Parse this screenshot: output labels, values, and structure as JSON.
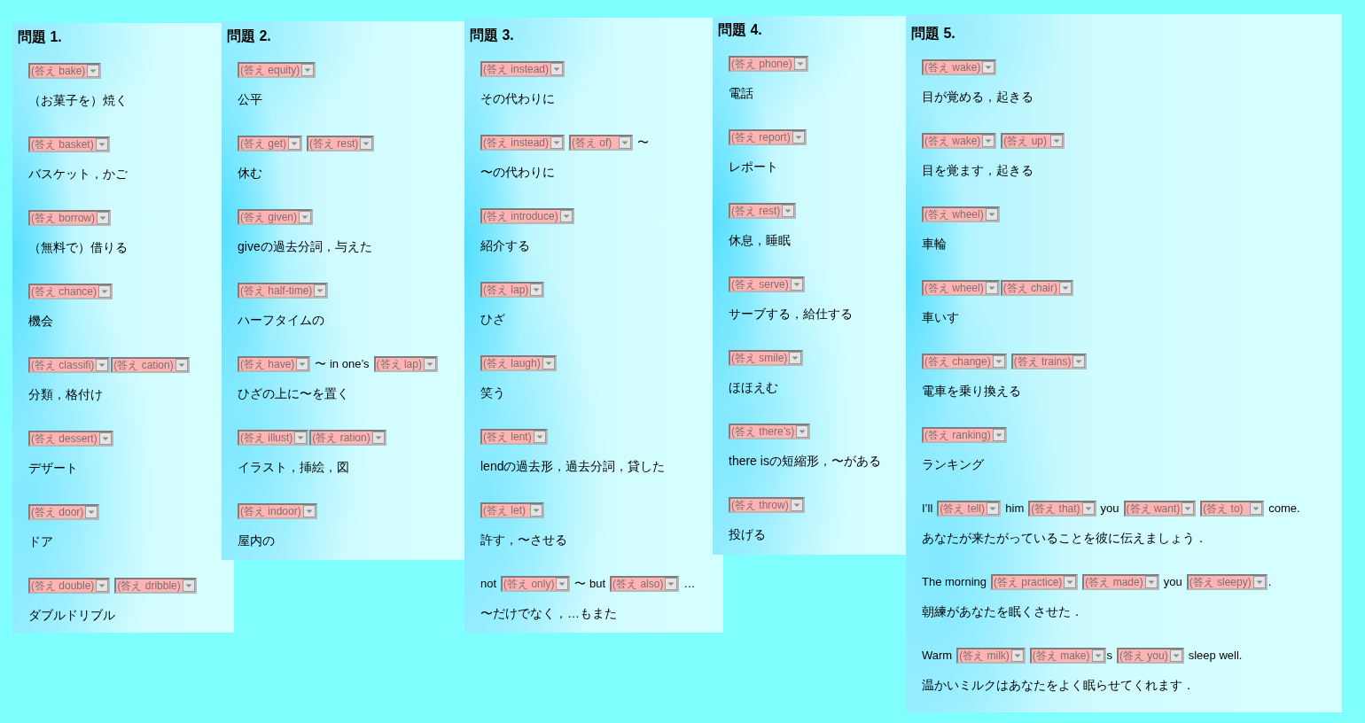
{
  "panels": [
    {
      "title": "問題 1.",
      "items": [
        {
          "prompt": [
            [
              {
                "kind": "select",
                "value": "(答え bake)",
                "disabled": true
              }
            ]
          ],
          "meaning": "（お菓子を）焼く"
        },
        {
          "prompt": [
            [
              {
                "kind": "select",
                "value": "(答え basket)",
                "disabled": true
              }
            ]
          ],
          "meaning": "バスケット，かご"
        },
        {
          "prompt": [
            [
              {
                "kind": "select",
                "value": "(答え borrow)",
                "disabled": true
              }
            ]
          ],
          "meaning": "（無料で）借りる"
        },
        {
          "prompt": [
            [
              {
                "kind": "select",
                "value": "(答え chance)",
                "disabled": true
              }
            ]
          ],
          "meaning": "機会"
        },
        {
          "prompt": [
            [
              {
                "kind": "select",
                "value": "(答え classifi)",
                "disabled": true
              },
              {
                "kind": "select",
                "value": "(答え cation)",
                "disabled": true
              }
            ]
          ],
          "meaning": "分類，格付け"
        },
        {
          "prompt": [
            [
              {
                "kind": "select",
                "value": "(答え dessert)",
                "disabled": true
              }
            ]
          ],
          "meaning": "デザート"
        },
        {
          "prompt": [
            [
              {
                "kind": "select",
                "value": "(答え door)",
                "disabled": true
              }
            ]
          ],
          "meaning": "ドア"
        },
        {
          "prompt": [
            [
              {
                "kind": "select",
                "value": "(答え double)",
                "disabled": true
              }
            ],
            [
              {
                "kind": "select",
                "value": "(答え dribble)",
                "disabled": true
              }
            ]
          ],
          "meaning": "ダブルドリブル"
        }
      ]
    },
    {
      "title": "問題 2.",
      "items": [
        {
          "prompt": [
            [
              {
                "kind": "select",
                "value": "(答え equity)",
                "disabled": true
              }
            ]
          ],
          "meaning": "公平"
        },
        {
          "prompt": [
            [
              {
                "kind": "select",
                "value": "(答え get)",
                "disabled": true
              }
            ],
            [
              {
                "kind": "select",
                "value": "(答え rest)",
                "disabled": true
              }
            ]
          ],
          "meaning": "休む"
        },
        {
          "prompt": [
            [
              {
                "kind": "select",
                "value": "(答え given)",
                "disabled": true
              }
            ]
          ],
          "meaning": "giveの過去分詞，与えた"
        },
        {
          "prompt": [
            [
              {
                "kind": "select",
                "value": "(答え half-time)",
                "disabled": true
              }
            ]
          ],
          "meaning": "ハーフタイムの"
        },
        {
          "prompt": [
            [
              {
                "kind": "select",
                "value": "(答え have)",
                "disabled": true
              }
            ],
            [
              {
                "kind": "text",
                "text": "〜 in one’s"
              }
            ],
            [
              {
                "kind": "select",
                "value": "(答え lap)",
                "disabled": true
              }
            ]
          ],
          "meaning": "ひざの上に〜を置く"
        },
        {
          "prompt": [
            [
              {
                "kind": "select",
                "value": "(答え illust)",
                "disabled": true
              },
              {
                "kind": "select",
                "value": "(答え ration)",
                "disabled": true
              }
            ]
          ],
          "meaning": "イラスト，挿絵，図"
        },
        {
          "prompt": [
            [
              {
                "kind": "select",
                "value": "(答え indoor)",
                "disabled": true
              }
            ]
          ],
          "meaning": "屋内の"
        }
      ]
    },
    {
      "title": "問題 3.",
      "items": [
        {
          "prompt": [
            [
              {
                "kind": "select",
                "value": "(答え instead)",
                "disabled": true
              }
            ]
          ],
          "meaning": "その代わりに"
        },
        {
          "prompt": [
            [
              {
                "kind": "select",
                "value": "(答え instead)",
                "disabled": true
              }
            ],
            [
              {
                "kind": "select",
                "value": "(答え of)",
                "disabled": true
              }
            ],
            [
              {
                "kind": "text",
                "text": "〜"
              }
            ]
          ],
          "meaning": "〜の代わりに"
        },
        {
          "prompt": [
            [
              {
                "kind": "select",
                "value": "(答え introduce)",
                "disabled": true
              }
            ]
          ],
          "meaning": "紹介する"
        },
        {
          "prompt": [
            [
              {
                "kind": "select",
                "value": "(答え lap)",
                "disabled": true
              }
            ]
          ],
          "meaning": "ひざ"
        },
        {
          "prompt": [
            [
              {
                "kind": "select",
                "value": "(答え laugh)",
                "disabled": true
              }
            ]
          ],
          "meaning": "笑う"
        },
        {
          "prompt": [
            [
              {
                "kind": "select",
                "value": "(答え lent)",
                "disabled": true
              }
            ]
          ],
          "meaning": "lendの過去形，過去分詞，貸した"
        },
        {
          "prompt": [
            [
              {
                "kind": "select",
                "value": "(答え let)",
                "disabled": true
              }
            ]
          ],
          "meaning": "許す，〜させる"
        },
        {
          "prompt": [
            [
              {
                "kind": "text",
                "text": "not"
              }
            ],
            [
              {
                "kind": "select",
                "value": "(答え only)",
                "disabled": true
              }
            ],
            [
              {
                "kind": "text",
                "text": "〜 but"
              }
            ],
            [
              {
                "kind": "select",
                "value": "(答え also)",
                "disabled": true
              }
            ],
            [
              {
                "kind": "text",
                "text": "…"
              }
            ]
          ],
          "meaning": "〜だけでなく，…もまた"
        }
      ]
    },
    {
      "title": "問題 4.",
      "items": [
        {
          "prompt": [
            [
              {
                "kind": "select",
                "value": "(答え phone)",
                "disabled": true
              }
            ]
          ],
          "meaning": "電話"
        },
        {
          "prompt": [
            [
              {
                "kind": "select",
                "value": "(答え report)",
                "disabled": true
              }
            ]
          ],
          "meaning": "レポート"
        },
        {
          "prompt": [
            [
              {
                "kind": "select",
                "value": "(答え rest)",
                "disabled": true
              }
            ]
          ],
          "meaning": "休息，睡眠"
        },
        {
          "prompt": [
            [
              {
                "kind": "select",
                "value": "(答え serve)",
                "disabled": true
              }
            ]
          ],
          "meaning": "サーブする，給仕する"
        },
        {
          "prompt": [
            [
              {
                "kind": "select",
                "value": "(答え smile)",
                "disabled": true
              }
            ]
          ],
          "meaning": "ほほえむ"
        },
        {
          "prompt": [
            [
              {
                "kind": "select",
                "value": "(答え there’s)",
                "disabled": true
              }
            ]
          ],
          "meaning": "there isの短縮形，〜がある"
        },
        {
          "prompt": [
            [
              {
                "kind": "select",
                "value": "(答え throw)",
                "disabled": true
              }
            ]
          ],
          "meaning": "投げる"
        }
      ]
    },
    {
      "title": "問題 5.",
      "items": [
        {
          "prompt": [
            [
              {
                "kind": "select",
                "value": "(答え wake)",
                "disabled": true
              }
            ]
          ],
          "meaning": "目が覚める，起きる"
        },
        {
          "prompt": [
            [
              {
                "kind": "select",
                "value": "(答え wake)",
                "disabled": true
              }
            ],
            [
              {
                "kind": "select",
                "value": "(答え up)",
                "disabled": true
              }
            ]
          ],
          "meaning": "目を覚ます，起きる"
        },
        {
          "prompt": [
            [
              {
                "kind": "select",
                "value": "(答え wheel)",
                "disabled": true
              }
            ]
          ],
          "meaning": "車輪"
        },
        {
          "prompt": [
            [
              {
                "kind": "select",
                "value": "(答え wheel)",
                "disabled": true
              },
              {
                "kind": "select",
                "value": "(答え chair)",
                "disabled": true
              }
            ]
          ],
          "meaning": "車いす"
        },
        {
          "prompt": [
            [
              {
                "kind": "select",
                "value": "(答え change)",
                "disabled": true
              }
            ],
            [
              {
                "kind": "select",
                "value": "(答え trains)",
                "disabled": true
              }
            ]
          ],
          "meaning": "電車を乗り換える"
        },
        {
          "prompt": [
            [
              {
                "kind": "select",
                "value": "(答え ranking)",
                "disabled": true
              }
            ]
          ],
          "meaning": "ランキング"
        },
        {
          "prompt": [
            [
              {
                "kind": "text",
                "text": "I’ll"
              }
            ],
            [
              {
                "kind": "select",
                "value": "(答え tell)",
                "disabled": true
              }
            ],
            [
              {
                "kind": "text",
                "text": "him"
              }
            ],
            [
              {
                "kind": "select",
                "value": "(答え that)",
                "disabled": true
              }
            ],
            [
              {
                "kind": "text",
                "text": "you"
              }
            ],
            [
              {
                "kind": "select",
                "value": "(答え want)",
                "disabled": true
              }
            ],
            [
              {
                "kind": "select",
                "value": "(答え to)",
                "disabled": true
              }
            ],
            [
              {
                "kind": "text",
                "text": "come."
              }
            ]
          ],
          "meaning": "あなたが来たがっていることを彼に伝えましょう．"
        },
        {
          "prompt": [
            [
              {
                "kind": "text",
                "text": "The morning"
              }
            ],
            [
              {
                "kind": "select",
                "value": "(答え practice)",
                "disabled": true
              }
            ],
            [
              {
                "kind": "select",
                "value": "(答え made)",
                "disabled": true
              }
            ],
            [
              {
                "kind": "text",
                "text": "you"
              }
            ],
            [
              {
                "kind": "select",
                "value": "(答え sleepy)",
                "disabled": true
              },
              {
                "kind": "text",
                "text": "."
              }
            ]
          ],
          "meaning": "朝練があなたを眠くさせた．"
        },
        {
          "prompt": [
            [
              {
                "kind": "text",
                "text": "Warm"
              }
            ],
            [
              {
                "kind": "select",
                "value": "(答え milk)",
                "disabled": true
              }
            ],
            [
              {
                "kind": "select",
                "value": "(答え make)",
                "disabled": true
              },
              {
                "kind": "text",
                "text": "s"
              }
            ],
            [
              {
                "kind": "select",
                "value": "(答え you)",
                "disabled": true
              }
            ],
            [
              {
                "kind": "text",
                "text": "sleep well."
              }
            ]
          ],
          "meaning": "温かいミルクはあなたをよく眠らせてくれます．"
        }
      ]
    }
  ]
}
